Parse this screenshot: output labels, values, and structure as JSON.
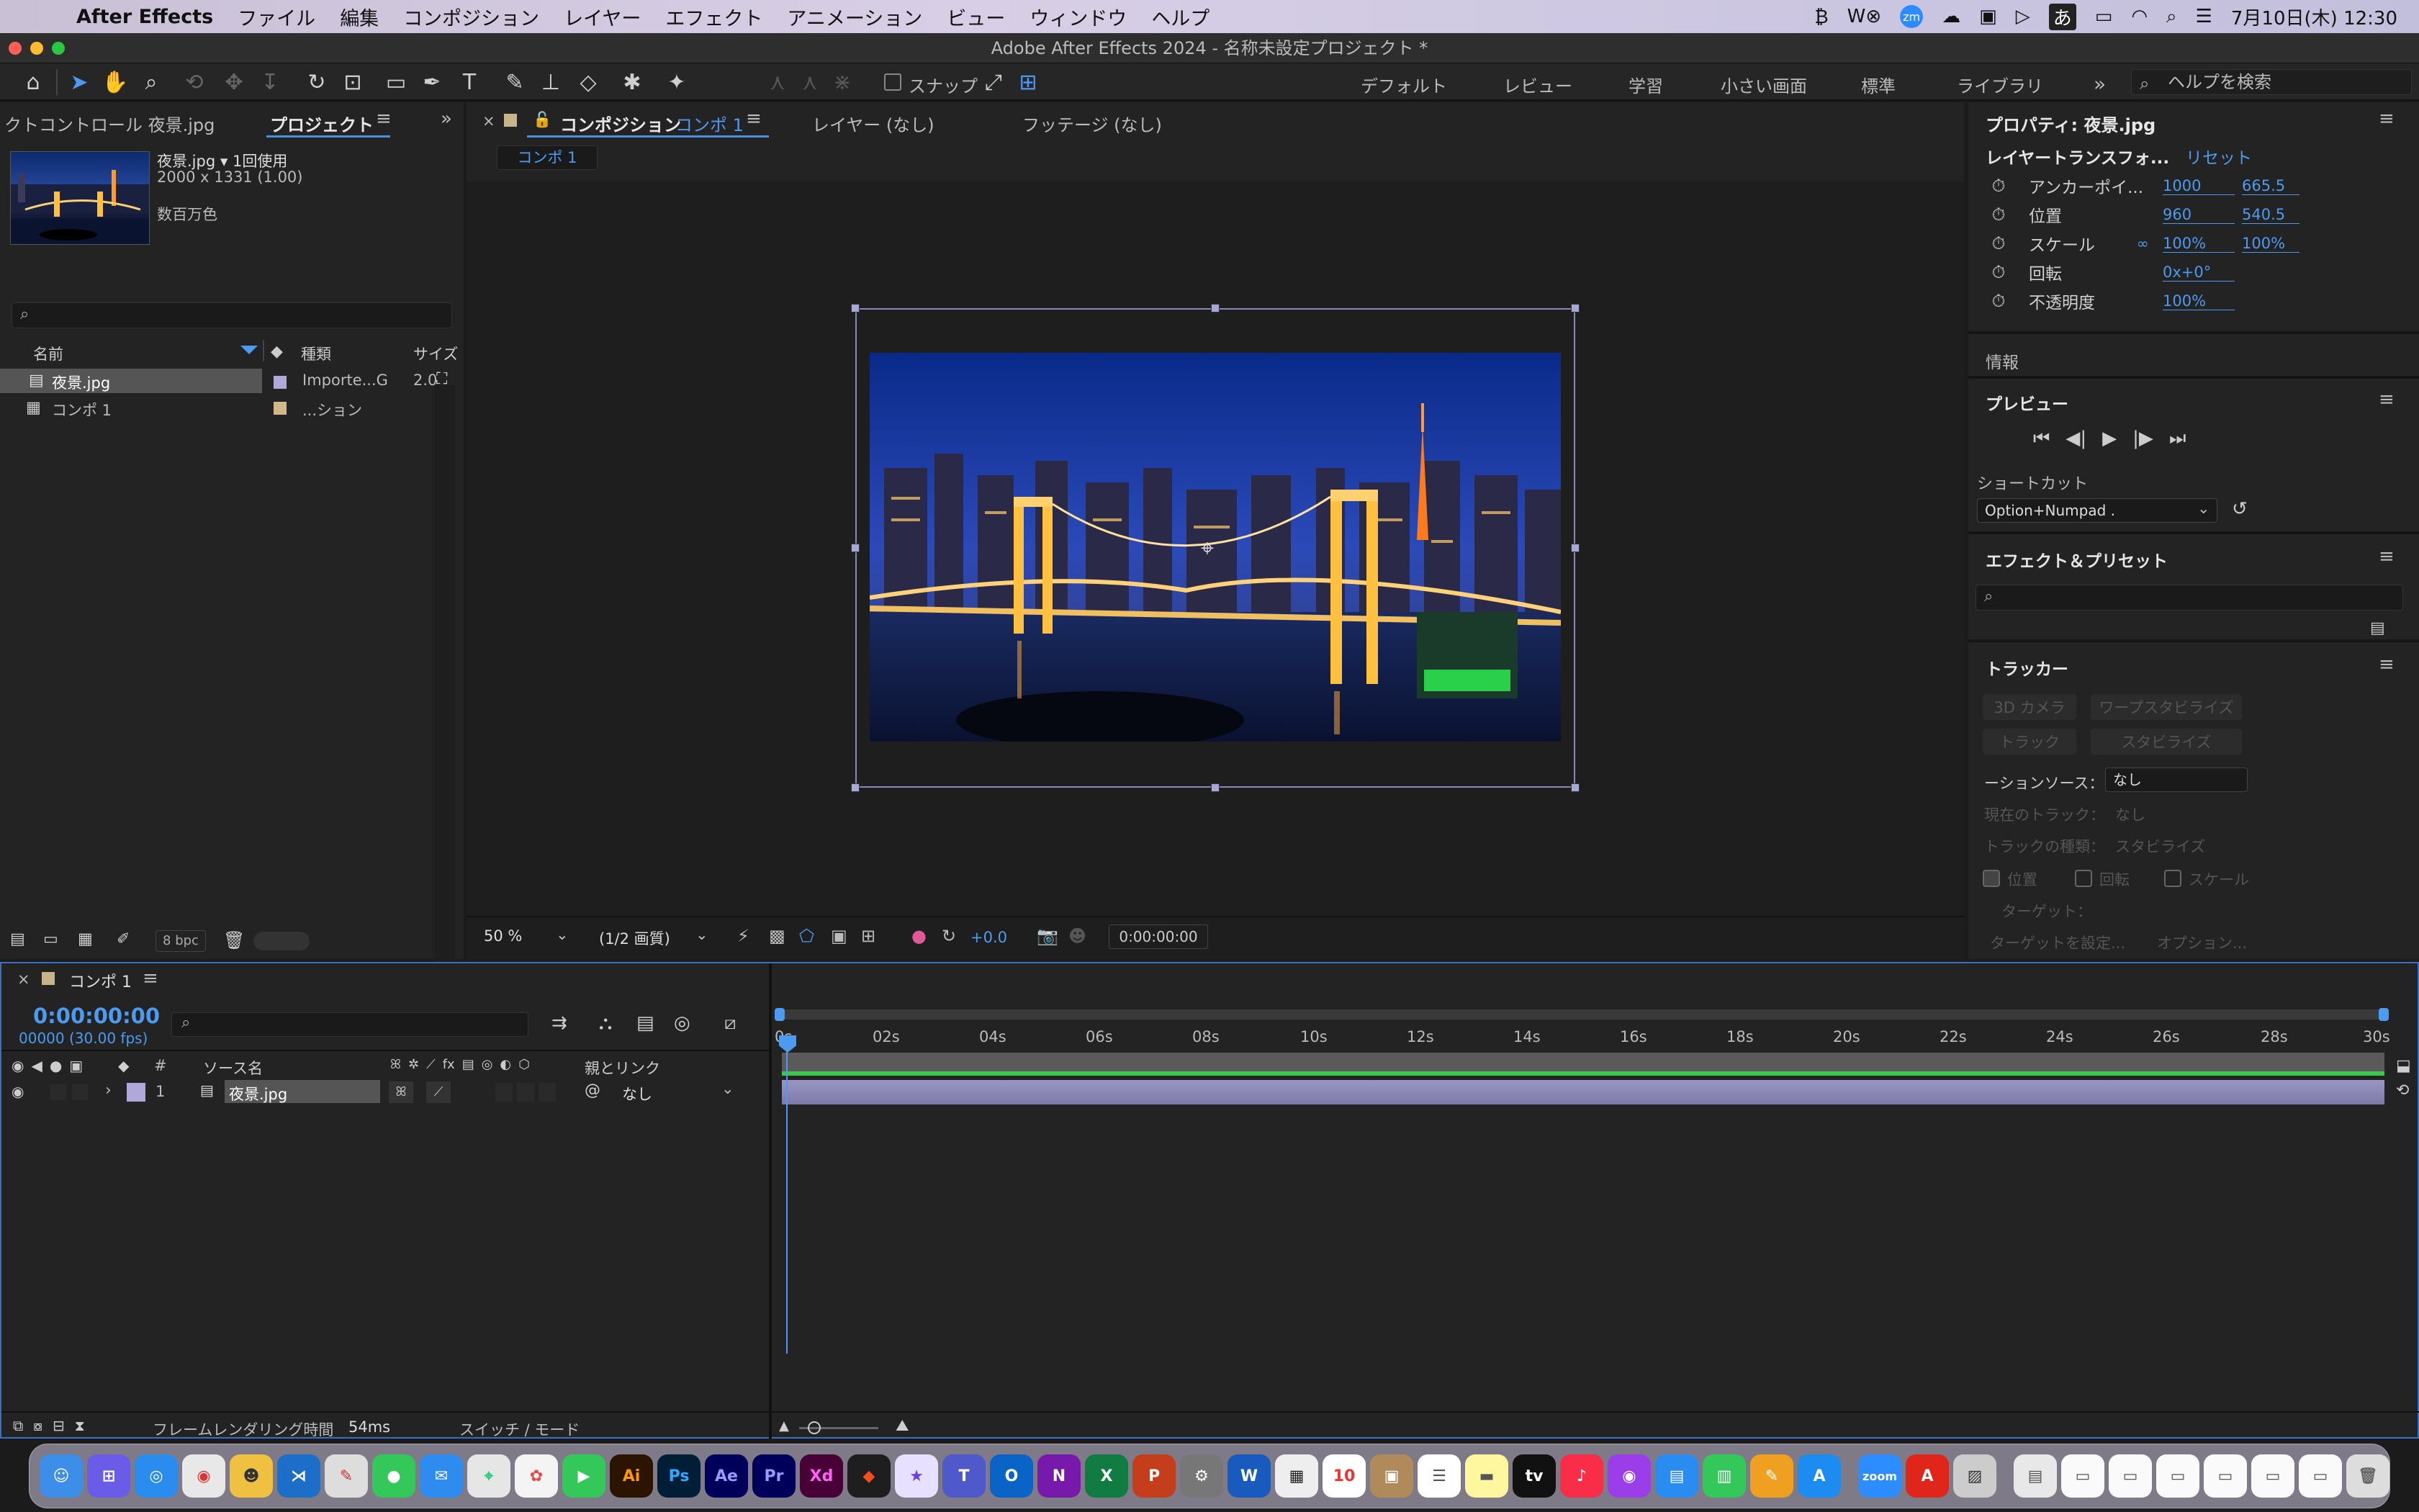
{
  "menubar": {
    "app_name": "After Effects",
    "items": [
      "ファイル",
      "編集",
      "コンポジション",
      "レイヤー",
      "エフェクト",
      "アニメーション",
      "ビュー",
      "ウィンドウ",
      "ヘルプ"
    ],
    "clock": "7月10日(木) 12:30",
    "ime": "あ"
  },
  "window": {
    "title": "Adobe After Effects 2024 - 名称未設定プロジェクト *"
  },
  "toolbar": {
    "snap_label": "スナップ",
    "workspaces": [
      "デフォルト",
      "レビュー",
      "学習",
      "小さい画面",
      "標準",
      "ライブラリ"
    ],
    "help_placeholder": "ヘルプを検索"
  },
  "project_panel": {
    "tab_effects": "クトコントロール 夜景.jpg",
    "tab_project": "プロジェクト",
    "file_name": "夜景.jpg ▾ 1回使用",
    "dimensions": "2000 x 1331 (1.00)",
    "colors": "数百万色",
    "columns": {
      "name": "名前",
      "type": "種類",
      "size": "サイズ"
    },
    "items": [
      {
        "name": "夜景.jpg",
        "type": "Importe...G",
        "size": "2.0"
      },
      {
        "name": "コンポ 1",
        "type": "...ション",
        "size": ""
      }
    ],
    "bpc": "8 bpc"
  },
  "comp_panel": {
    "tab_comp": "コンポジション",
    "comp_name": "コンポ 1",
    "tab_layer": "レイヤー (なし)",
    "tab_footage": "フッテージ (なし)",
    "breadcrumb": "コンポ 1",
    "zoom": "50 %",
    "resolution": "(1/2 画質)",
    "exposure": "+0.0",
    "timecode": "0:00:00:00"
  },
  "properties": {
    "title": "プロパティ: 夜景.jpg",
    "section": "レイヤートランスフォ...",
    "reset": "リセット",
    "rows": [
      {
        "label": "アンカーポイ...",
        "v1": "1000",
        "v2": "665.5"
      },
      {
        "label": "位置",
        "v1": "960",
        "v2": "540.5"
      },
      {
        "label": "スケール",
        "v1": "100%",
        "v2": "100%"
      },
      {
        "label": "回転",
        "v1": "0x+0°",
        "v2": ""
      },
      {
        "label": "不透明度",
        "v1": "100%",
        "v2": ""
      }
    ]
  },
  "info_panel": {
    "title": "情報"
  },
  "preview_panel": {
    "title": "プレビュー",
    "shortcut_label": "ショートカット",
    "shortcut_value": "Option+Numpad ."
  },
  "effects_panel": {
    "title": "エフェクト＆プリセット"
  },
  "tracker_panel": {
    "title": "トラッカー",
    "btn_3d": "3D カメラ",
    "btn_warp": "ワープスタビライズ",
    "btn_track": "トラック",
    "btn_stabilize": "スタビライズ",
    "motion_source_label": "ーションソース：",
    "motion_source_value": "なし",
    "current_track_label": "現在のトラック：",
    "current_track_value": "なし",
    "track_type_label": "トラックの種類：",
    "track_type_value": "スタビライズ",
    "chk_position": "位置",
    "chk_rotation": "回転",
    "chk_scale": "スケール",
    "target_label": "ターゲット：",
    "set_target": "ターゲットを設定...",
    "options": "オプション..."
  },
  "timeline": {
    "comp_name": "コンポ 1",
    "timecode": "0:00:00:00",
    "frame_info": "00000 (30.00 fps)",
    "col_num": "#",
    "col_source": "ソース名",
    "col_parent": "親とリンク",
    "ruler": [
      "0s",
      "02s",
      "04s",
      "06s",
      "08s",
      "10s",
      "12s",
      "14s",
      "16s",
      "18s",
      "20s",
      "22s",
      "24s",
      "26s",
      "28s",
      "30s"
    ],
    "layers": [
      {
        "num": "1",
        "name": "夜景.jpg",
        "parent": "なし"
      }
    ],
    "render_time_label": "フレームレンダリング時間",
    "render_time_value": "54ms",
    "switch_mode": "スイッチ / モード"
  },
  "dock": {
    "labels": [
      "Ai",
      "Ps",
      "Ae",
      "Pr",
      "Xd",
      "10",
      "zoom",
      "tv"
    ]
  }
}
